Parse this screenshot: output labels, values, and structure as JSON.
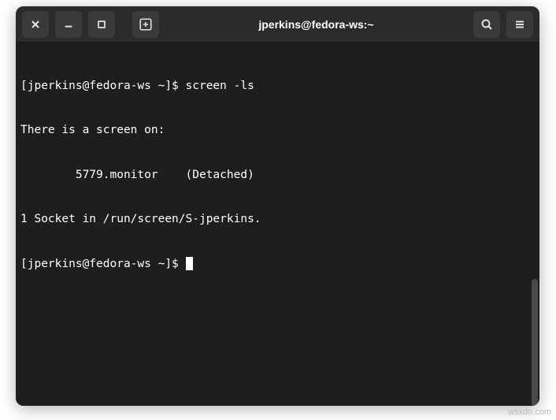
{
  "titlebar": {
    "title": "jperkins@fedora-ws:~"
  },
  "terminal": {
    "lines": [
      {
        "prompt": "[jperkins@fedora-ws ~]$ ",
        "command": "screen -ls"
      },
      {
        "text": "There is a screen on:"
      },
      {
        "text": "        5779.monitor    (Detached)"
      },
      {
        "text": "1 Socket in /run/screen/S-jperkins."
      },
      {
        "prompt": "[jperkins@fedora-ws ~]$ ",
        "cursor": true
      }
    ]
  },
  "watermark": "wsxdn.com"
}
